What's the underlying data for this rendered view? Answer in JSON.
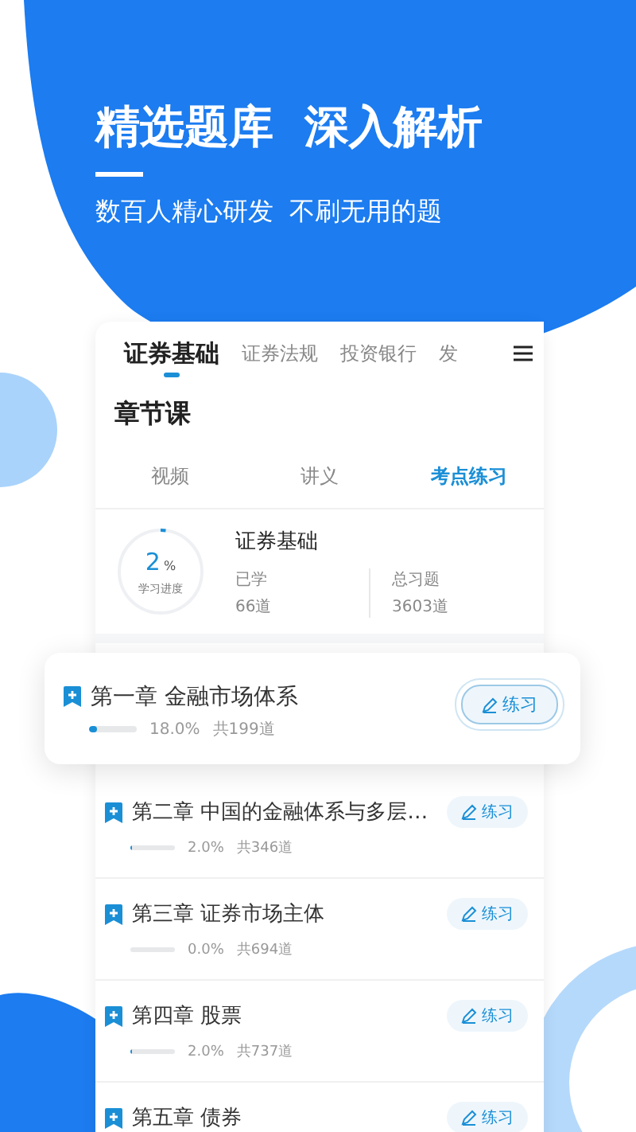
{
  "hero": {
    "title": "精选题库  深入解析",
    "subtitle": "数百人精心研发  不刷无用的题"
  },
  "subject_tabs": [
    {
      "label": "证券基础",
      "selected": true
    },
    {
      "label": "证券法规",
      "selected": false
    },
    {
      "label": "投资银行",
      "selected": false
    },
    {
      "label": "发",
      "selected": false
    }
  ],
  "section_title": "章节课",
  "course_tabs": [
    {
      "label": "视频",
      "selected": false
    },
    {
      "label": "讲义",
      "selected": false
    },
    {
      "label": "考点练习",
      "selected": true
    }
  ],
  "summary": {
    "progress_value": "2",
    "progress_unit": "%",
    "progress_label": "学习进度",
    "level": 0.02,
    "subject": "证券基础",
    "stats": [
      {
        "label": "已学",
        "value": "66道"
      },
      {
        "label": "总习题",
        "value": "3603道"
      }
    ]
  },
  "chapters": [
    {
      "title": "第一章 金融市场体系",
      "highlighted": true,
      "level": 0.18,
      "percent": "18.0%",
      "total": "共199道",
      "action": "练习"
    },
    {
      "title": "第二章 中国的金融体系与多层…",
      "highlighted": false,
      "level": 0.02,
      "percent": "2.0%",
      "total": "共346道",
      "action": "练习"
    },
    {
      "title": "第三章 证券市场主体",
      "highlighted": false,
      "level": 0,
      "percent": "0.0%",
      "total": "共694道",
      "action": "练习"
    },
    {
      "title": "第四章 股票",
      "highlighted": false,
      "level": 0.02,
      "percent": "2.0%",
      "total": "共737道",
      "action": "练习"
    },
    {
      "title": "第五章 债券",
      "highlighted": false,
      "action": "练习"
    }
  ]
}
